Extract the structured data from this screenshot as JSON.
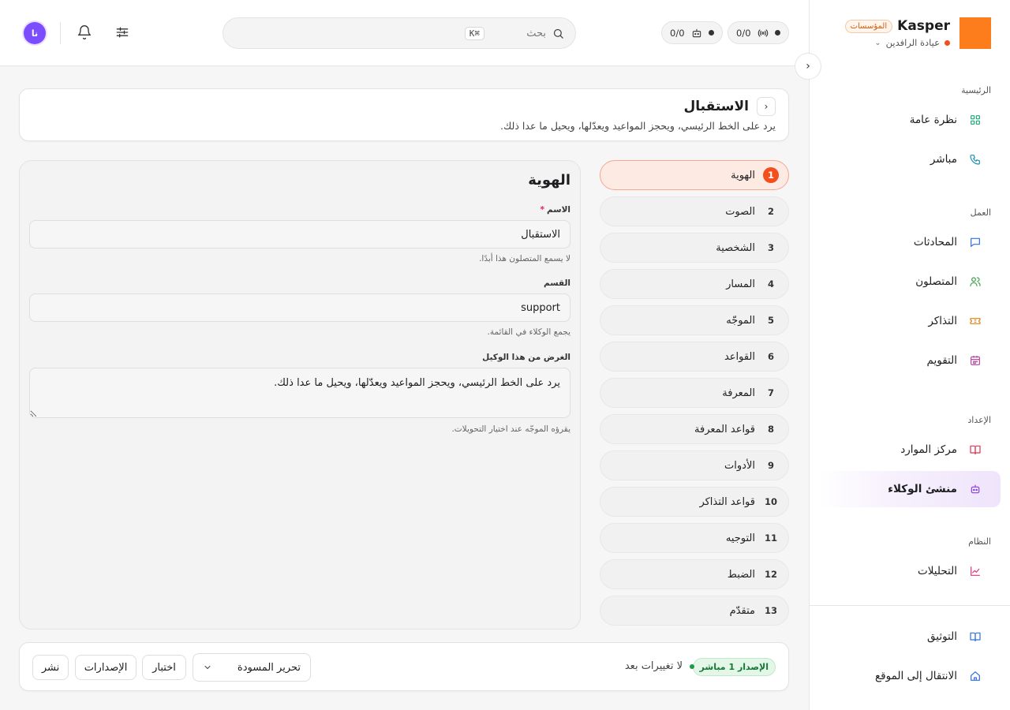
{
  "brand": {
    "name": "Kasper",
    "badge": "المؤسسات",
    "workspace": "عيادة الرافدين",
    "logo_color": "#fd7d1d"
  },
  "topbar": {
    "stat_calls": "0/0",
    "stat_bots": "0/0",
    "search_placeholder": "بحث",
    "search_shortcut": "⌘K",
    "avatar_initials": "نا"
  },
  "sidebar": {
    "sections": [
      {
        "heading": "الرئيسية",
        "items": [
          {
            "label": "نظرة عامة",
            "icon": "grid-icon"
          },
          {
            "label": "مباشر",
            "icon": "phone-icon"
          }
        ]
      },
      {
        "heading": "العمل",
        "items": [
          {
            "label": "المحادثات",
            "icon": "chat-icon"
          },
          {
            "label": "المتصلون",
            "icon": "users-icon"
          },
          {
            "label": "التذاكر",
            "icon": "ticket-icon"
          },
          {
            "label": "التقويم",
            "icon": "calendar-icon"
          }
        ]
      },
      {
        "heading": "الإعداد",
        "items": [
          {
            "label": "مركز الموارد",
            "icon": "book-icon"
          },
          {
            "label": "منشئ الوكلاء",
            "icon": "bot-icon",
            "active": true
          }
        ]
      },
      {
        "heading": "النظام",
        "items": [
          {
            "label": "التحليلات",
            "icon": "chart-icon"
          }
        ]
      }
    ],
    "footer": [
      {
        "label": "التوثيق",
        "icon": "docs-icon"
      },
      {
        "label": "الانتقال إلى الموقع",
        "icon": "home-icon"
      }
    ]
  },
  "page": {
    "title": "الاستقبال",
    "description": "يرد على الخط الرئيسي، ويحجز المواعيد ويعدّلها، ويحيل ما عدا ذلك."
  },
  "steps": [
    {
      "num": "1",
      "label": "الهوية",
      "active": true
    },
    {
      "num": "2",
      "label": "الصوت"
    },
    {
      "num": "3",
      "label": "الشخصية"
    },
    {
      "num": "4",
      "label": "المسار"
    },
    {
      "num": "5",
      "label": "الموجّه"
    },
    {
      "num": "6",
      "label": "القواعد"
    },
    {
      "num": "7",
      "label": "المعرفة"
    },
    {
      "num": "8",
      "label": "قواعد المعرفة"
    },
    {
      "num": "9",
      "label": "الأدوات"
    },
    {
      "num": "10",
      "label": "قواعد التذاكر"
    },
    {
      "num": "11",
      "label": "التوجيه"
    },
    {
      "num": "12",
      "label": "الضبط"
    },
    {
      "num": "13",
      "label": "متقدّم"
    }
  ],
  "form": {
    "title": "الهوية",
    "name_label": "الاسم",
    "name_required": "*",
    "name_value": "الاستقبال",
    "name_hint": "لا يسمع المتصلون هذا أبدًا.",
    "dept_label": "القسم",
    "dept_value": "support",
    "dept_hint": "يجمع الوكلاء في القائمة.",
    "purpose_label": "الغرض من هذا الوكيل",
    "purpose_value": "يرد على الخط الرئيسي، ويحجز المواعيد ويعدّلها، ويحيل ما عدا ذلك.",
    "purpose_hint": "يقرؤه الموجّه عند اختيار التحويلات."
  },
  "actions": {
    "version_badge": "الإصدار 1 مباشر",
    "status": "لا تغييرات بعد",
    "draft_select": "تحرير المسودة",
    "test": "اختبار",
    "versions": "الإصدارات",
    "publish": "نشر"
  },
  "colors": {
    "accent": "#f24e1e",
    "active_nav": "#efe4fb",
    "live_green": "#1c9a45"
  }
}
